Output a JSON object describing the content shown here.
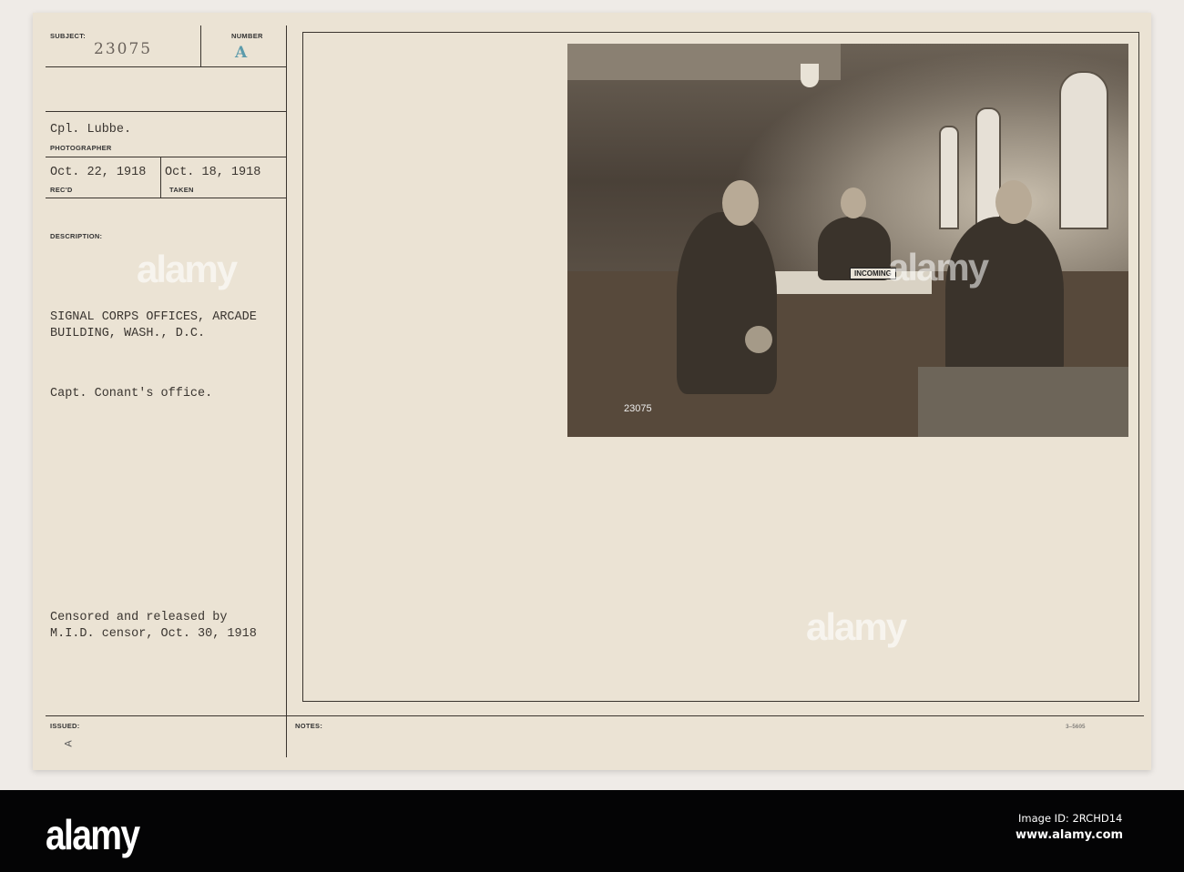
{
  "card": {
    "subject_label": "SUBJECT:",
    "subject_value": "23075",
    "number_label": "NUMBER",
    "number_value": "A",
    "photographer_value": "Cpl. Lubbe.",
    "photographer_label": "PHOTOGRAPHER",
    "received_value": "Oct. 22, 1918",
    "received_label": "REC'D",
    "taken_value": "Oct. 18, 1918",
    "taken_label": "TAKEN",
    "description_label": "DESCRIPTION:",
    "description_line1": "SIGNAL CORPS OFFICES, ARCADE",
    "description_line2": "BUILDING, WASH., D.C.",
    "note": "Capt. Conant's office.",
    "censor_line1": "Censored and released by",
    "censor_line2": "M.I.D. censor, Oct. 30, 1918",
    "issued_label": "ISSUED:",
    "issued_mark": "A",
    "notes_label": "NOTES:",
    "form_number": "3—5605"
  },
  "photo": {
    "sign_text": "INCOMING",
    "negative_number": "23075"
  },
  "watermark": "alamy",
  "footer": {
    "logo": "alamy",
    "image_id": "Image ID: 2RCHD14",
    "site": "www.alamy.com"
  }
}
